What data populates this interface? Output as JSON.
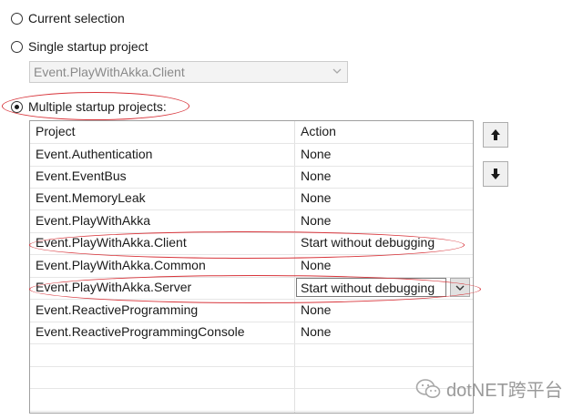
{
  "options": {
    "current_selection": "Current selection",
    "single_startup": "Single startup project",
    "single_project_value": "Event.PlayWithAkka.Client",
    "multiple_startup": "Multiple startup projects:"
  },
  "grid": {
    "headers": [
      "Project",
      "Action"
    ],
    "rows": [
      {
        "project": "Event.Authentication",
        "action": "None"
      },
      {
        "project": "Event.EventBus",
        "action": "None"
      },
      {
        "project": "Event.MemoryLeak",
        "action": "None"
      },
      {
        "project": "Event.PlayWithAkka",
        "action": "None"
      },
      {
        "project": "Event.PlayWithAkka.Client",
        "action": "Start without debugging"
      },
      {
        "project": "Event.PlayWithAkka.Common",
        "action": "None"
      },
      {
        "project": "Event.PlayWithAkka.Server",
        "action": "Start without debugging"
      },
      {
        "project": "Event.ReactiveProgramming",
        "action": "None"
      },
      {
        "project": "Event.ReactiveProgrammingConsole",
        "action": "None"
      }
    ]
  },
  "watermark": {
    "text": "dotNET跨平台"
  },
  "colors": {
    "highlight": "#d8363c"
  }
}
